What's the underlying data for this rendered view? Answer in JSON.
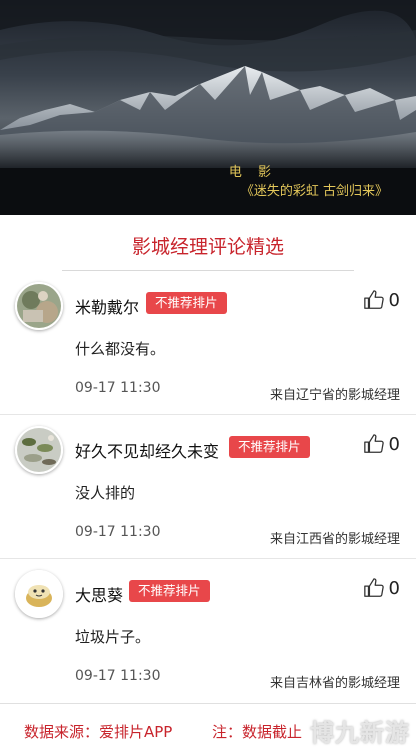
{
  "banner": {
    "subtitle_line1": "电 影",
    "subtitle_line2": "《迷失的彩虹 古剑归来》"
  },
  "section": {
    "title": "影城经理评论精选"
  },
  "reviews": [
    {
      "username": "米勒戴尔",
      "badge": "不推荐排片",
      "likes": "0",
      "comment": "什么都没有。",
      "time": "09-17 11:30",
      "source": "来自辽宁省的影城经理"
    },
    {
      "username": "好久不见却经久未变",
      "badge": "不推荐排片",
      "likes": "0",
      "comment": "没人排的",
      "time": "09-17 11:30",
      "source": "来自江西省的影城经理"
    },
    {
      "username": "大思葵",
      "badge": "不推荐排片",
      "likes": "0",
      "comment": "垃圾片子。",
      "time": "09-17 11:30",
      "source": "来自吉林省的影城经理"
    }
  ],
  "footer": {
    "left": "数据来源：爱排片APP",
    "right": "注：数据截止",
    "watermark": "博九新游"
  },
  "colors": {
    "accent": "#c8242c",
    "badge": "#e8474a",
    "subtitle": "#e3c75a"
  },
  "icons": [
    "thumbs-up-icon"
  ]
}
